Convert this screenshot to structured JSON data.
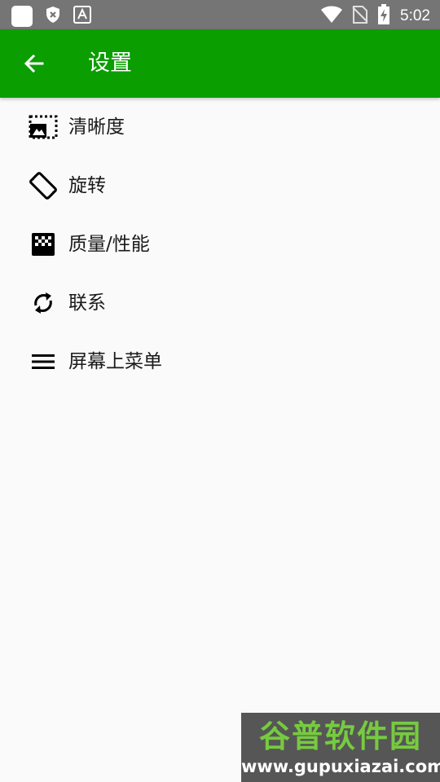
{
  "status_bar": {
    "time": "5:02",
    "icons": [
      "notification-square-icon",
      "shield-x-icon",
      "keyboard-a-icon",
      "wifi-icon",
      "no-sim-icon",
      "battery-charging-icon"
    ]
  },
  "app_bar": {
    "title": "设置",
    "background_color": "#0a9e00",
    "back_icon": "arrow-back-icon"
  },
  "settings": {
    "items": [
      {
        "label": "清晰度",
        "icon": "resolution-icon"
      },
      {
        "label": "旋转",
        "icon": "screen-rotation-icon"
      },
      {
        "label": "质量/性能",
        "icon": "quality-gradient-icon"
      },
      {
        "label": "联系",
        "icon": "sync-icon"
      },
      {
        "label": "屏幕上菜单",
        "icon": "menu-icon"
      }
    ]
  },
  "watermark": {
    "title": "谷普软件园",
    "url": "www.gupuxiazai.com"
  }
}
